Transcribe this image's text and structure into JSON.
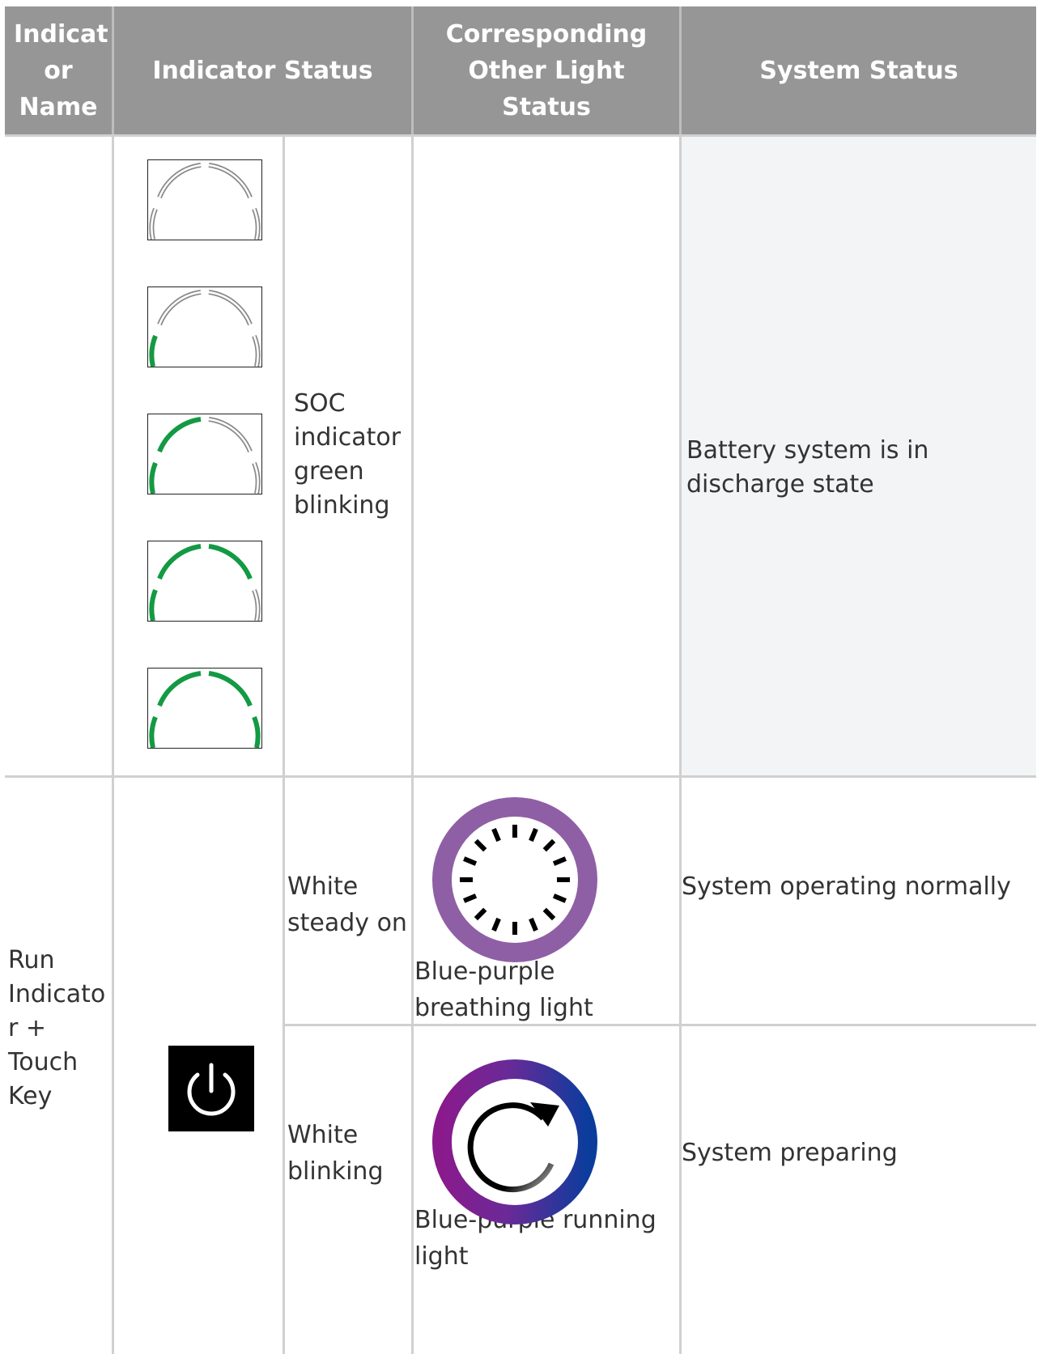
{
  "header": {
    "indicator_name": "Indicat or Name",
    "indicator_status": "Indicator Status",
    "corresponding_other": "Corresponding Other Light Status",
    "system_status": "System Status"
  },
  "rows": [
    {
      "name": "",
      "soc_levels_lit": [
        0,
        1,
        2,
        3,
        4
      ],
      "status": "SOC indicator green blinking",
      "other": "",
      "system": "Battery system is in discharge state"
    },
    {
      "name": "Run Indicato r + Touch Key",
      "icon": "power-icon",
      "sub": [
        {
          "status": "White steady on",
          "other_icon": "breathing-light-icon",
          "other": "Blue-purple breathing light",
          "system": "System operating normally"
        },
        {
          "status": "White blinking",
          "other_icon": "running-light-icon",
          "other": "Blue-purple running light",
          "system": "System preparing"
        }
      ]
    }
  ],
  "colors": {
    "header_bg": "#969696",
    "grid_line": "#d0d0d0",
    "soc_green": "#139a43",
    "breathing_purple": "#8f5fa6",
    "running_purple": "#8a1a8c",
    "running_blue": "#0b3c9c",
    "system_cell_bg": "#f3f4f6"
  }
}
